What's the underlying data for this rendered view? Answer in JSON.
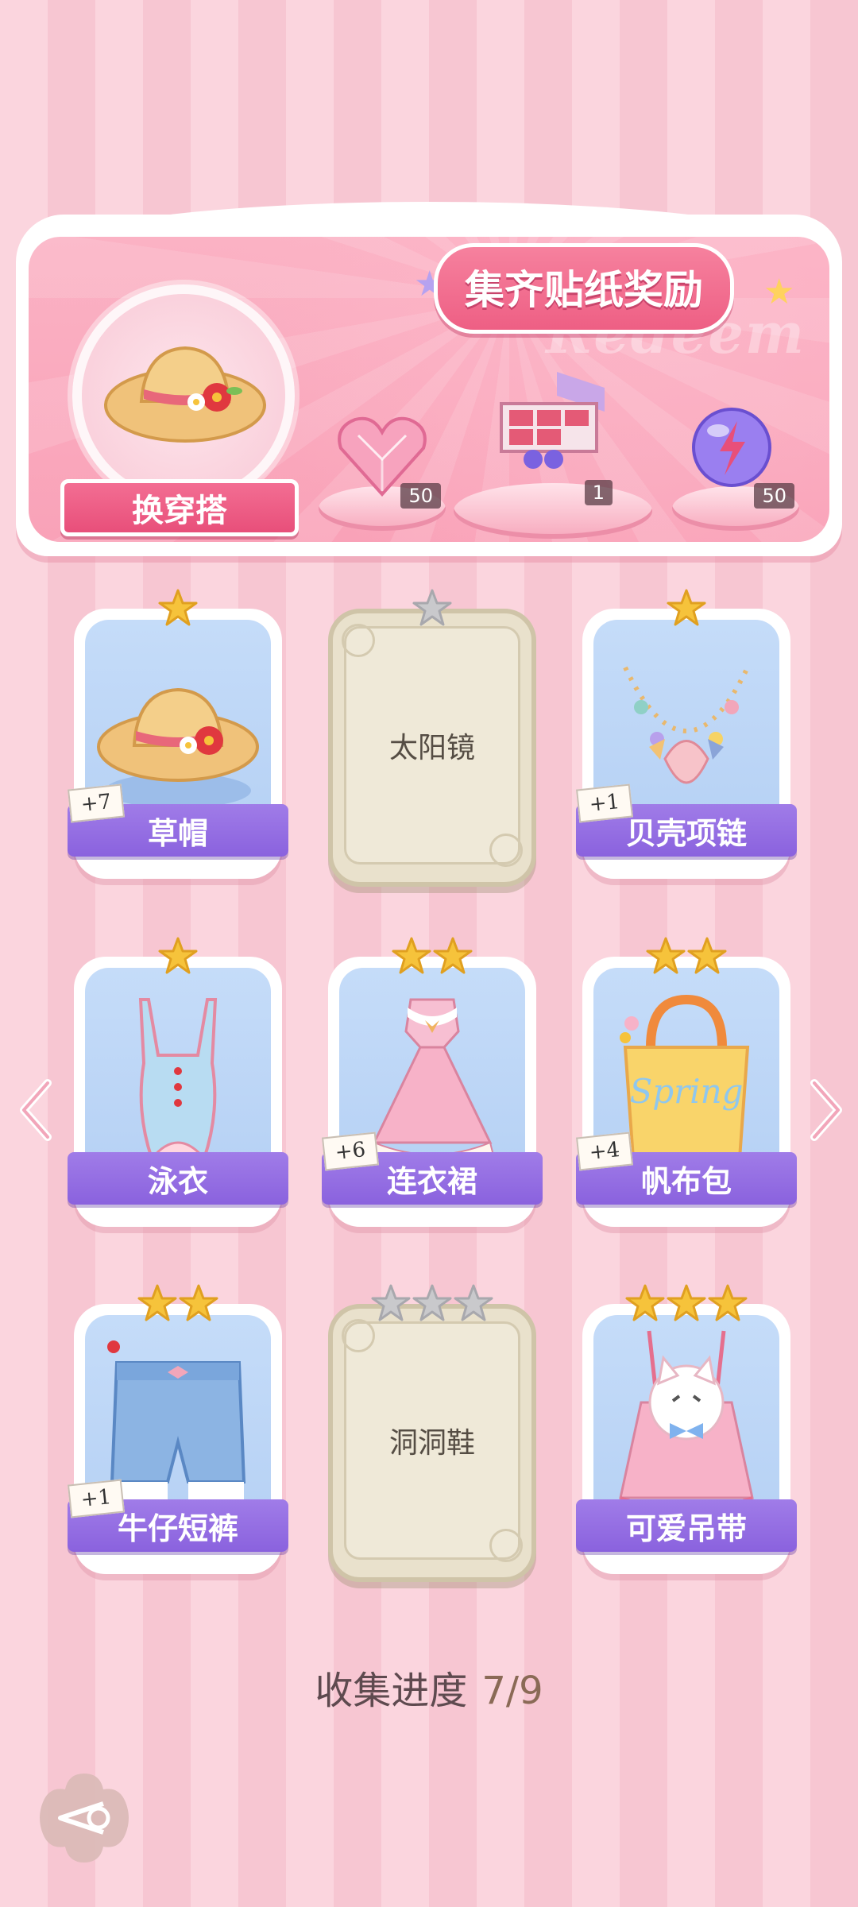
{
  "banner": {
    "title": "集齐贴纸奖励",
    "watermark": "Redeem",
    "change_outfit_label": "换穿搭",
    "rewards": [
      {
        "name": "pink-heart-gem",
        "count": "50"
      },
      {
        "name": "gift-box",
        "count": "1"
      },
      {
        "name": "energy-orb",
        "count": "50"
      }
    ]
  },
  "cards": [
    {
      "label": "草帽",
      "stars": 1,
      "locked": false,
      "plus": "+7",
      "item": "straw-hat"
    },
    {
      "label": "太阳镜",
      "stars": 1,
      "locked": true,
      "plus": "",
      "item": "sunglasses"
    },
    {
      "label": "贝壳项链",
      "stars": 1,
      "locked": false,
      "plus": "+1",
      "item": "shell-necklace"
    },
    {
      "label": "泳衣",
      "stars": 1,
      "locked": false,
      "plus": "",
      "item": "swimsuit"
    },
    {
      "label": "连衣裙",
      "stars": 2,
      "locked": false,
      "plus": "+6",
      "item": "dress"
    },
    {
      "label": "帆布包",
      "stars": 2,
      "locked": false,
      "plus": "+4",
      "item": "canvas-bag"
    },
    {
      "label": "牛仔短裤",
      "stars": 2,
      "locked": false,
      "plus": "+1",
      "item": "denim-shorts"
    },
    {
      "label": "洞洞鞋",
      "stars": 3,
      "locked": true,
      "plus": "",
      "item": "clogs"
    },
    {
      "label": "可爱吊带",
      "stars": 3,
      "locked": false,
      "plus": "",
      "item": "cute-camisole"
    }
  ],
  "progress": {
    "label": "收集进度",
    "value": "7/9"
  },
  "colors": {
    "accent_pink": "#ee5f84",
    "label_purple": "#8a62de",
    "star_gold": "#f6c33b",
    "star_gray": "#c9c9cc"
  }
}
